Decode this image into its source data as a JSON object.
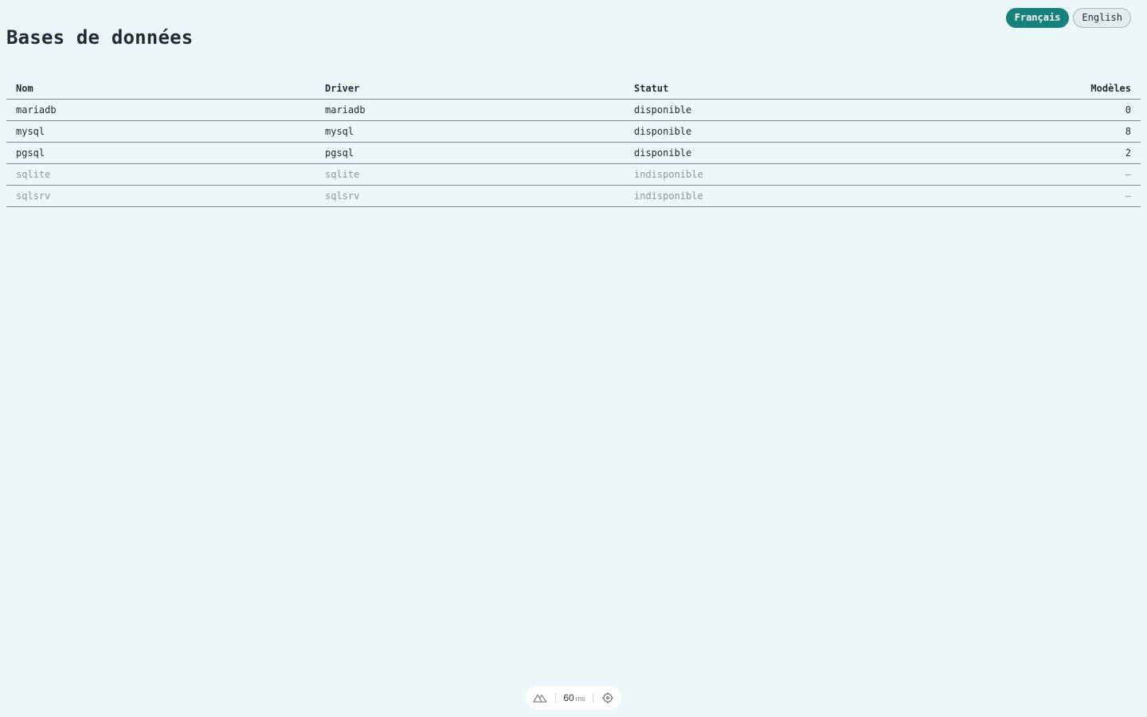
{
  "page": {
    "title": "Bases de données"
  },
  "language_switch": {
    "options": [
      {
        "label": "Français",
        "active": true
      },
      {
        "label": "English",
        "active": false
      }
    ]
  },
  "table": {
    "headers": {
      "name": "Nom",
      "driver": "Driver",
      "status": "Statut",
      "models": "Modèles"
    },
    "rows": [
      {
        "name": "mariadb",
        "driver": "mariadb",
        "status": "disponible",
        "models": "0",
        "available": true
      },
      {
        "name": "mysql",
        "driver": "mysql",
        "status": "disponible",
        "models": "8",
        "available": true
      },
      {
        "name": "pgsql",
        "driver": "pgsql",
        "status": "disponible",
        "models": "2",
        "available": true
      },
      {
        "name": "sqlite",
        "driver": "sqlite",
        "status": "indisponible",
        "models": "—",
        "available": false
      },
      {
        "name": "sqlsrv",
        "driver": "sqlsrv",
        "status": "indisponible",
        "models": "—",
        "available": false
      }
    ]
  },
  "devtools": {
    "logo_icon": "nuxt-logo-icon",
    "render_time": "60",
    "render_unit": "ms",
    "inspect_icon": "crosshair-icon"
  },
  "colors": {
    "background": "#ecf7f9",
    "accent": "#17817b",
    "muted_text": "#8c979c"
  }
}
